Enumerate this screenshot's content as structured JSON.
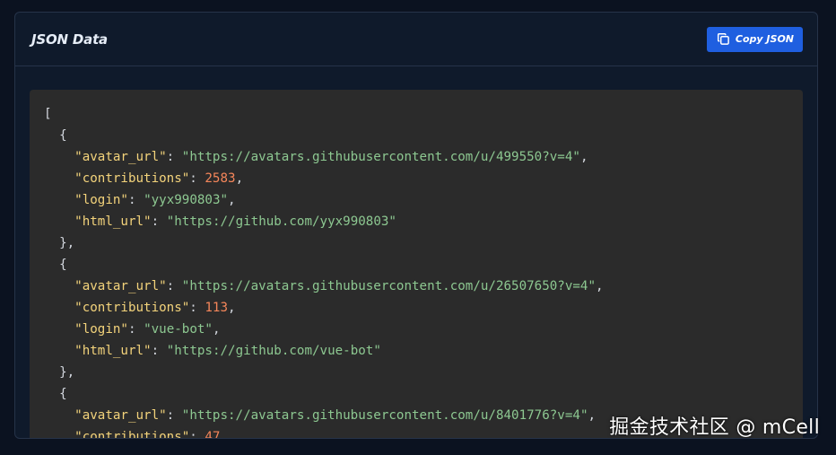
{
  "header": {
    "title": "JSON Data",
    "copy_label": "Copy JSON",
    "copy_icon": "copy-icon"
  },
  "colors": {
    "accent": "#1f5fe0",
    "key": "#f3d37b",
    "string": "#8dc891",
    "number": "#f5865a"
  },
  "records": [
    {
      "avatar_url": "https://avatars.githubusercontent.com/u/499550?v=4",
      "contributions": "2583",
      "login": "yyx990803",
      "html_url": "https://github.com/yyx990803"
    },
    {
      "avatar_url": "https://avatars.githubusercontent.com/u/26507650?v=4",
      "contributions": "113",
      "login": "vue-bot",
      "html_url": "https://github.com/vue-bot"
    },
    {
      "avatar_url": "https://avatars.githubusercontent.com/u/8401776?v=4",
      "contributions": "47"
    }
  ],
  "watermark": "掘金技术社区 @ mCell"
}
